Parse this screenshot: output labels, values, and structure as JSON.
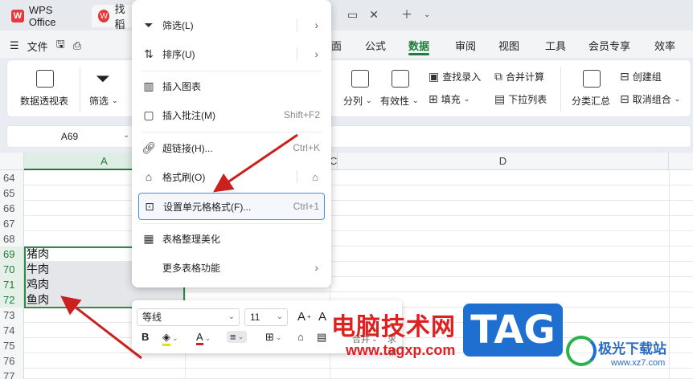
{
  "titlebar": {
    "app_tab": "WPS Office",
    "doc_tab": "找稻",
    "doc_tab_icon": "W"
  },
  "menubar": {
    "file": "文件",
    "items": [
      {
        "label": "面"
      },
      {
        "label": "公式"
      },
      {
        "label": "数据",
        "active": true
      },
      {
        "label": "审阅"
      },
      {
        "label": "视图"
      },
      {
        "label": "工具"
      },
      {
        "label": "会员专享"
      },
      {
        "label": "效率"
      }
    ]
  },
  "ribbon": {
    "pivot": "数据透视表",
    "filter": "筛选",
    "split": "分列",
    "validity": "有效性",
    "lookup": "查找录入",
    "fill": "填充",
    "merge_calc": "合并计算",
    "dropdown": "下拉列表",
    "subtotal": "分类汇总",
    "group": "创建组",
    "ungroup": "取消组合"
  },
  "formula_bar": {
    "name_box": "A69"
  },
  "sheet": {
    "columns": [
      "A",
      "C",
      "D"
    ],
    "rows": [
      {
        "num": "64",
        "a": ""
      },
      {
        "num": "65",
        "a": ""
      },
      {
        "num": "66",
        "a": ""
      },
      {
        "num": "67",
        "a": ""
      },
      {
        "num": "68",
        "a": ""
      },
      {
        "num": "69",
        "a": "猪肉",
        "sel": true
      },
      {
        "num": "70",
        "a": "牛肉",
        "sel": true
      },
      {
        "num": "71",
        "a": "鸡肉",
        "sel": true
      },
      {
        "num": "72",
        "a": "鱼肉",
        "sel": true
      },
      {
        "num": "73",
        "a": ""
      },
      {
        "num": "74",
        "a": ""
      },
      {
        "num": "75",
        "a": ""
      },
      {
        "num": "76",
        "a": ""
      },
      {
        "num": "77",
        "a": ""
      }
    ]
  },
  "context_menu": {
    "items": [
      {
        "icon": "filter-icon",
        "label": "筛选(L)",
        "submenu": true
      },
      {
        "icon": "sort-icon",
        "label": "排序(U)",
        "submenu": true
      },
      {
        "icon": "chart-icon",
        "label": "插入图表"
      },
      {
        "icon": "comment-icon",
        "label": "插入批注(M)",
        "shortcut": "Shift+F2"
      },
      {
        "icon": "link-icon",
        "label": "超链接(H)...",
        "shortcut": "Ctrl+K"
      },
      {
        "icon": "format-painter-icon",
        "label": "格式刷(O)"
      },
      {
        "icon": "cell-format-icon",
        "label": "设置单元格格式(F)...",
        "shortcut": "Ctrl+1",
        "highlighted": true
      },
      {
        "icon": "table-beautify-icon",
        "label": "表格整理美化"
      },
      {
        "icon": "",
        "label": "更多表格功能",
        "submenu": true
      }
    ]
  },
  "float_toolbar": {
    "font": "等线",
    "size": "11",
    "merge": "合并",
    "sum": "求和"
  },
  "watermark": {
    "text": "电脑技术网",
    "url": "www.tagxp.com",
    "logo": "TAG",
    "brand": "极光下载站",
    "brand_url": "www.xz7.com"
  },
  "colors": {
    "accent": "#1e7d3a",
    "selection_border": "#2e8b47",
    "highlight_border": "#4a90d9",
    "arrow": "#cc1f1f"
  }
}
